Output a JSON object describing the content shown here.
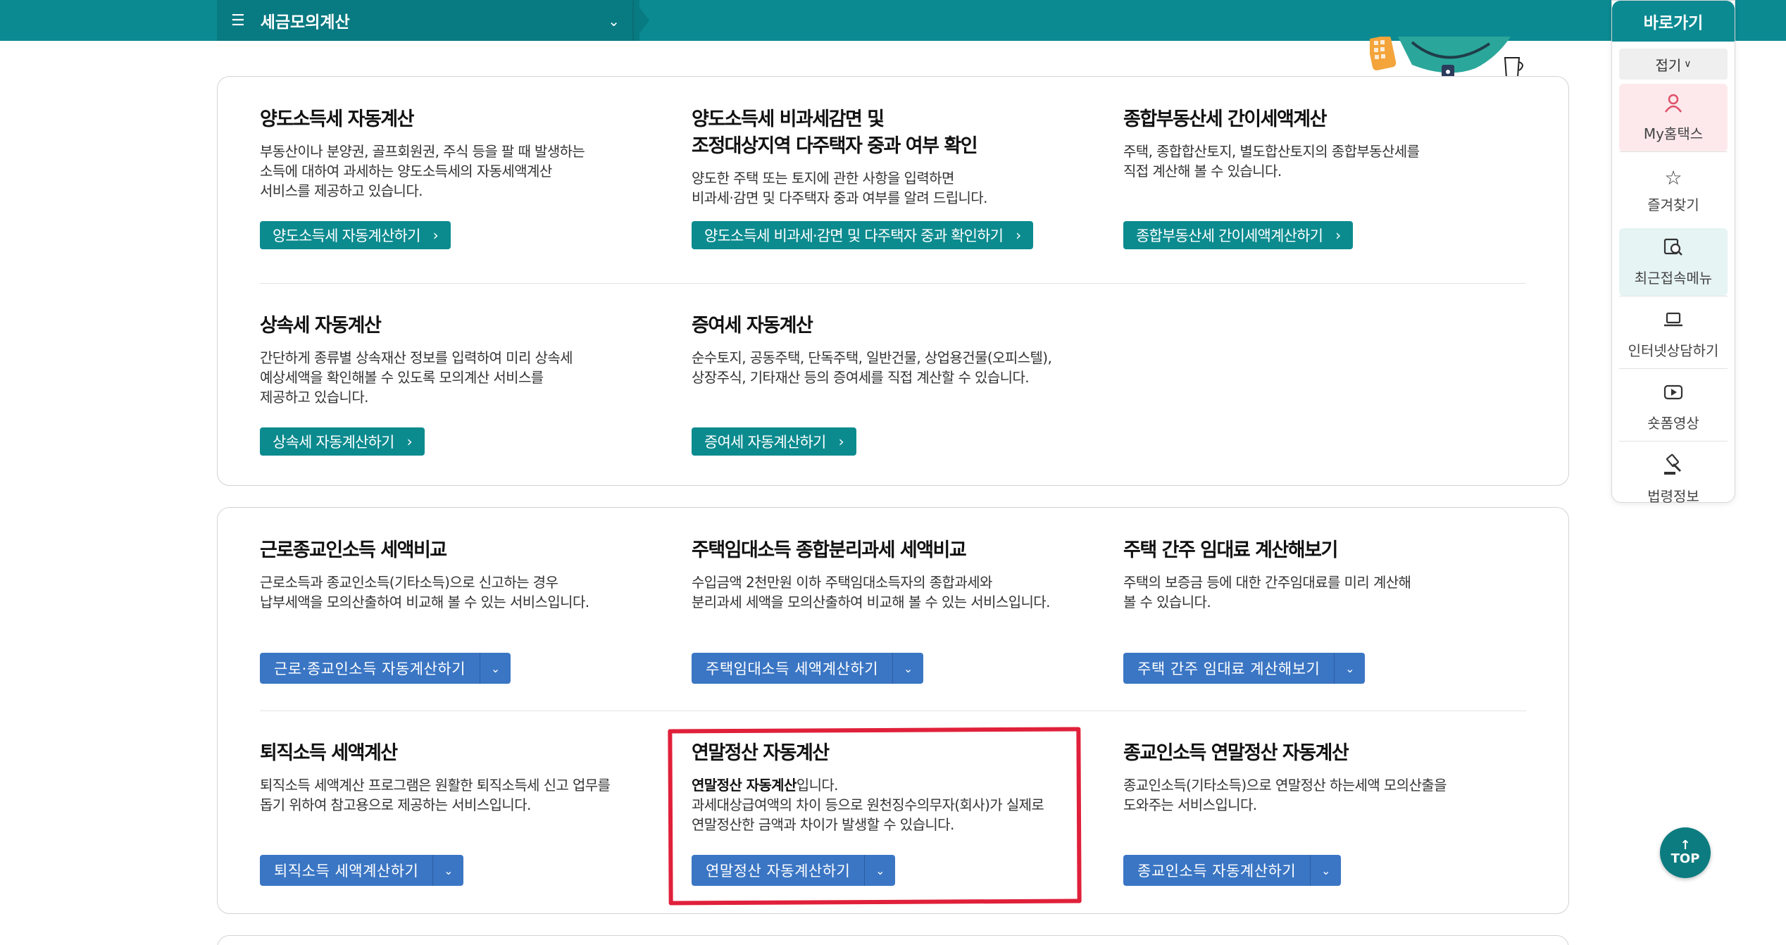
{
  "topbar": {
    "menu_title": "세금모의계산",
    "menu_icon": "hamburger-icon",
    "chevron_icon": "chevron-down-icon"
  },
  "section1": {
    "items": [
      {
        "title": "양도소득세 자동계산",
        "desc": [
          "부동산이나 분양권, 골프회원권, 주식 등을 팔 때 발생하는",
          "소득에 대하여 과세하는 양도소득세의 자동세액계산",
          "서비스를 제공하고 있습니다."
        ],
        "button": "양도소득세 자동계산하기"
      },
      {
        "title_lines": [
          "양도소득세 비과세감면 및",
          "조정대상지역 다주택자 중과 여부 확인"
        ],
        "desc": [
          "양도한 주택 또는 토지에 관한 사항을 입력하면",
          "비과세·감면 및 다주택자 중과 여부를 알려 드립니다."
        ],
        "button": "양도소득세 비과세·감면 및 다주택자 중과 확인하기"
      },
      {
        "title": "종합부동산세 간이세액계산",
        "desc": [
          "주택, 종합합산토지, 별도합산토지의 종합부동산세를",
          "직접 계산해 볼 수 있습니다."
        ],
        "button": "종합부동산세 간이세액계산하기"
      },
      {
        "title": "상속세 자동계산",
        "desc": [
          "간단하게 종류별 상속재산 정보를 입력하여 미리 상속세",
          "예상세액을 확인해볼 수 있도록 모의계산 서비스를",
          "제공하고 있습니다."
        ],
        "button": "상속세 자동계산하기"
      },
      {
        "title": "증여세 자동계산",
        "desc": [
          "순수토지, 공동주택, 단독주택, 일반건물, 상업용건물(오피스텔),",
          "상장주식, 기타재산 등의 증여세를 직접 계산할 수 있습니다."
        ],
        "button": "증여세 자동계산하기"
      }
    ]
  },
  "section2": {
    "items": [
      {
        "title": "근로종교인소득 세액비교",
        "desc": [
          "근로소득과 종교인소득(기타소득)으로 신고하는 경우",
          "납부세액을 모의산출하여 비교해 볼 수 있는 서비스입니다."
        ],
        "button": "근로·종교인소득 자동계산하기"
      },
      {
        "title": "주택임대소득 종합분리과세 세액비교",
        "desc": [
          "수입금액 2천만원 이하 주택임대소득자의 종합과세와",
          "분리과세 세액을 모의산출하여 비교해 볼 수 있는 서비스입니다."
        ],
        "button": "주택임대소득 세액계산하기"
      },
      {
        "title": "주택 간주 임대료 계산해보기",
        "desc": [
          "주택의 보증금 등에 대한 간주임대료를 미리 계산해",
          "볼 수 있습니다."
        ],
        "button": "주택 간주 임대료 계산해보기"
      },
      {
        "title": "퇴직소득 세액계산",
        "desc": [
          "퇴직소득 세액계산 프로그램은 원활한 퇴직소득세 신고 업무를",
          "돕기 위하여 참고용으로 제공하는 서비스입니다."
        ],
        "button": "퇴직소득 세액계산하기"
      },
      {
        "title": "연말정산 자동계산",
        "desc_bold": "연말정산 자동계산",
        "desc_first_rest": "입니다.",
        "desc": [
          "과세대상급여액의 차이 등으로 원천징수의무자(회사)가 실제로",
          "연말정산한 금액과 차이가 발생할 수 있습니다."
        ],
        "button": "연말정산 자동계산하기"
      },
      {
        "title": "종교인소득 연말정산 자동계산",
        "desc": [
          "종교인소득(기타소득)으로 연말정산 하는세액 모의산출을",
          "도와주는 서비스입니다."
        ],
        "button": "종교인소득 자동계산하기"
      }
    ]
  },
  "quick": {
    "header": "바로가기",
    "fold": "접기",
    "items": [
      {
        "label": "My홈택스",
        "icon": "user-icon"
      },
      {
        "label": "즐겨찾기",
        "icon": "star-icon"
      },
      {
        "label": "최근접속메뉴",
        "icon": "recent-search-icon"
      },
      {
        "label": "인터넷상담하기",
        "icon": "laptop-icon"
      },
      {
        "label": "숏폼영상",
        "icon": "play-icon"
      },
      {
        "label": "법령정보",
        "icon": "gavel-icon"
      }
    ]
  },
  "top_button": {
    "label": "TOP"
  }
}
